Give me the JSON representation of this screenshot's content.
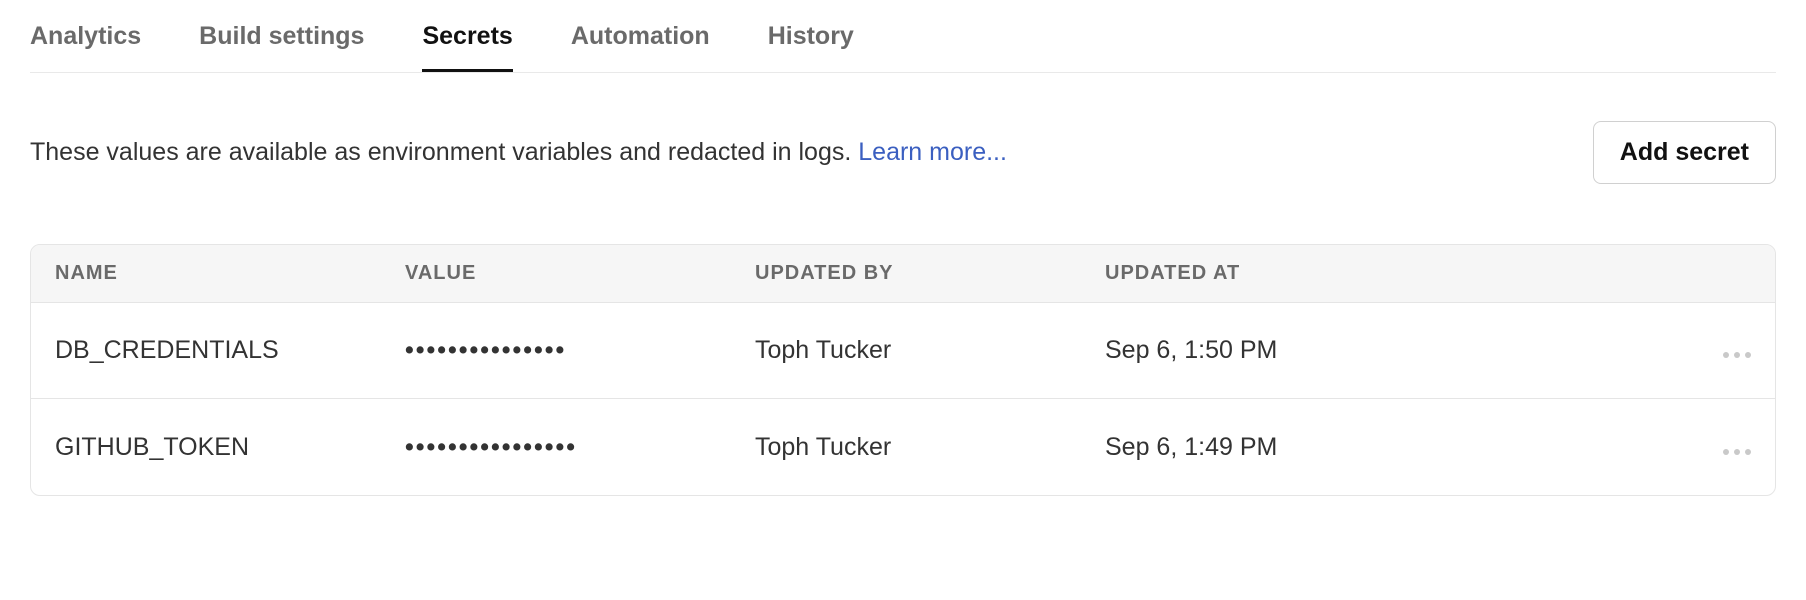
{
  "tabs": [
    {
      "label": "Analytics",
      "active": false
    },
    {
      "label": "Build settings",
      "active": false
    },
    {
      "label": "Secrets",
      "active": true
    },
    {
      "label": "Automation",
      "active": false
    },
    {
      "label": "History",
      "active": false
    }
  ],
  "description": "These values are available as environment variables and redacted in logs. ",
  "learn_more": "Learn more...",
  "add_secret_label": "Add secret",
  "table": {
    "headers": {
      "name": "NAME",
      "value": "VALUE",
      "updated_by": "UPDATED BY",
      "updated_at": "UPDATED AT"
    },
    "rows": [
      {
        "name": "DB_CREDENTIALS",
        "value": "•••••••••••••••",
        "updated_by": "Toph Tucker",
        "updated_at": "Sep 6, 1:50 PM"
      },
      {
        "name": "GITHUB_TOKEN",
        "value": "••••••••••••••••",
        "updated_by": "Toph Tucker",
        "updated_at": "Sep 6, 1:49 PM"
      }
    ]
  }
}
